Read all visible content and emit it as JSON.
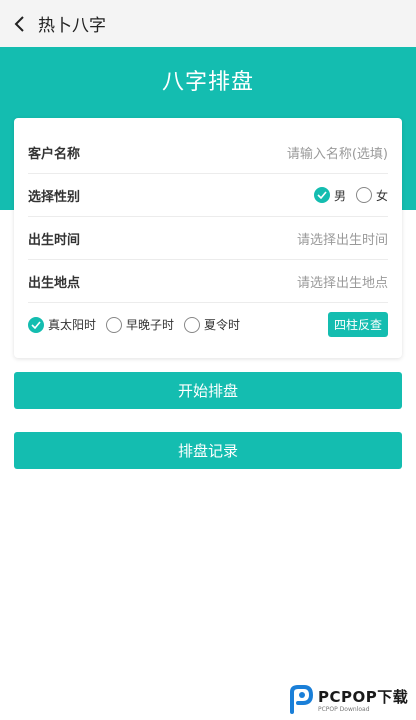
{
  "header": {
    "title": "热卜八字"
  },
  "hero": {
    "title": "八字排盘"
  },
  "form": {
    "customer_name": {
      "label": "客户名称",
      "placeholder": "请输入名称(选填)"
    },
    "gender": {
      "label": "选择性别",
      "options": [
        "男",
        "女"
      ],
      "selected": "男"
    },
    "birth_time": {
      "label": "出生时间",
      "placeholder": "请选择出生时间"
    },
    "birth_place": {
      "label": "出生地点",
      "placeholder": "请选择出生地点"
    },
    "time_options": [
      {
        "label": "真太阳时",
        "checked": true
      },
      {
        "label": "早晚子时",
        "checked": false
      },
      {
        "label": "夏令时",
        "checked": false
      }
    ],
    "reverse_button": "四柱反查"
  },
  "buttons": {
    "start": "开始排盘",
    "history": "排盘记录"
  },
  "watermark": {
    "brand": "PCPOP下载",
    "sub": "PCPOP Download"
  },
  "colors": {
    "accent": "#14bdb0",
    "topbar": "#f4f4f4"
  }
}
